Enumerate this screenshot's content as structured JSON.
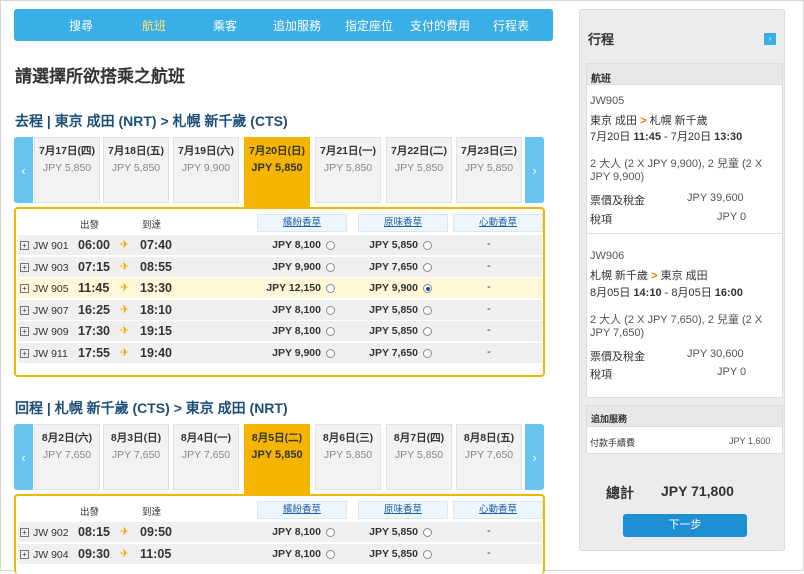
{
  "nav": [
    "搜尋",
    "航班",
    "乘客",
    "追加服務",
    "指定座位",
    "支付的費用",
    "行程表"
  ],
  "page_title": "請選擇所欲搭乘之航班",
  "outbound": {
    "title": "去程 | 東京 成田 (NRT) > 札幌 新千歲 (CTS)",
    "dates": [
      {
        "date": "7月17日(四)",
        "price": "JPY 5,850"
      },
      {
        "date": "7月18日(五)",
        "price": "JPY 5,850"
      },
      {
        "date": "7月19日(六)",
        "price": "JPY 9,900"
      },
      {
        "date": "7月20日(日)",
        "price": "JPY 5,850"
      },
      {
        "date": "7月21日(一)",
        "price": "JPY 5,850"
      },
      {
        "date": "7月22日(二)",
        "price": "JPY 5,850"
      },
      {
        "date": "7月23日(三)",
        "price": "JPY 5,850"
      }
    ],
    "header": {
      "dep": "出發",
      "arr": "到達",
      "fare1": "繽紛香草",
      "fare2": "原味香草",
      "fare3": "心動香草"
    },
    "rows": [
      {
        "no": "JW 901",
        "dep": "06:00",
        "arr": "07:40",
        "p1": "JPY 8,100",
        "p2": "JPY 5,850",
        "p3": "-"
      },
      {
        "no": "JW 903",
        "dep": "07:15",
        "arr": "08:55",
        "p1": "JPY 9,900",
        "p2": "JPY 7,650",
        "p3": "-"
      },
      {
        "no": "JW 905",
        "dep": "11:45",
        "arr": "13:30",
        "p1": "JPY 12,150",
        "p2": "JPY 9,900",
        "p3": "-"
      },
      {
        "no": "JW 907",
        "dep": "16:25",
        "arr": "18:10",
        "p1": "JPY 8,100",
        "p2": "JPY 5,850",
        "p3": "-"
      },
      {
        "no": "JW 909",
        "dep": "17:30",
        "arr": "19:15",
        "p1": "JPY 8,100",
        "p2": "JPY 5,850",
        "p3": "-"
      },
      {
        "no": "JW 911",
        "dep": "17:55",
        "arr": "19:40",
        "p1": "JPY 9,900",
        "p2": "JPY 7,650",
        "p3": "-"
      }
    ]
  },
  "inbound": {
    "title": "回程 | 札幌 新千歲 (CTS) > 東京 成田 (NRT)",
    "dates": [
      {
        "date": "8月2日(六)",
        "price": "JPY 7,650"
      },
      {
        "date": "8月3日(日)",
        "price": "JPY 7,650"
      },
      {
        "date": "8月4日(一)",
        "price": "JPY 7,650"
      },
      {
        "date": "8月5日(二)",
        "price": "JPY 5,850"
      },
      {
        "date": "8月6日(三)",
        "price": "JPY 5,850"
      },
      {
        "date": "8月7日(四)",
        "price": "JPY 5,850"
      },
      {
        "date": "8月8日(五)",
        "price": "JPY 7,650"
      }
    ],
    "header": {
      "dep": "出發",
      "arr": "到達",
      "fare1": "繽紛香草",
      "fare2": "原味香草",
      "fare3": "心動香草"
    },
    "rows": [
      {
        "no": "JW 902",
        "dep": "08:15",
        "arr": "09:50",
        "p1": "JPY 8,100",
        "p2": "JPY 5,850",
        "p3": "-"
      },
      {
        "no": "JW 904",
        "dep": "09:30",
        "arr": "11:05",
        "p1": "JPY 8,100",
        "p2": "JPY 5,850",
        "p3": "-"
      }
    ]
  },
  "itinerary": {
    "title": "行程",
    "flights_header": "航班",
    "leg1": {
      "flight": "JW905",
      "from": "東京 成田",
      "to": "札幌 新千歲",
      "time_a": "7月20日 ",
      "time_b": "11:45",
      "time_c": " - 7月20日 ",
      "time_d": "13:30",
      "pax1": "2 大人 (2 X JPY 9,900), 2 兒童 (2 X",
      "pax2": "JPY 9,900)",
      "fare_lbl": "票價及稅金",
      "fare_val": "JPY 39,600",
      "tax_lbl": "稅項",
      "tax_val": "JPY 0"
    },
    "leg2": {
      "flight": "JW906",
      "from": "札幌 新千歲",
      "to": "東京 成田",
      "time_a": "8月05日 ",
      "time_b": "14:10",
      "time_c": " - 8月05日 ",
      "time_d": "16:00",
      "pax1": "2 大人 (2 X JPY 7,650), 2 兒童 (2 X",
      "pax2": "JPY 7,650)",
      "fare_lbl": "票價及稅金",
      "fare_val": "JPY 30,600",
      "tax_lbl": "稅項",
      "tax_val": "JPY 0"
    },
    "extras_header": "追加服務",
    "fee_lbl": "付款手續費",
    "fee_val": "JPY 1,600",
    "total_lbl": "總計",
    "total_val": "JPY 71,800",
    "next": "下一步"
  }
}
